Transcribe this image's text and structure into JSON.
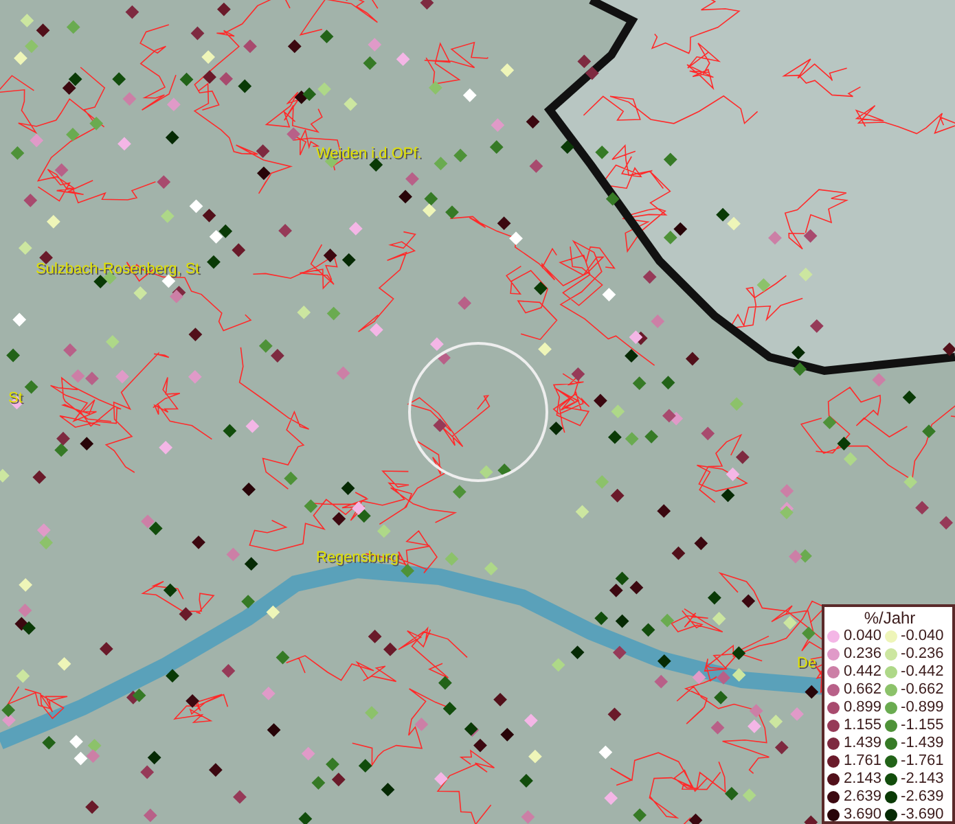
{
  "map": {
    "place_labels": [
      {
        "text": "Weiden i.d.OPf."
      },
      {
        "text": "Sulzbach-Rosenberg, St"
      },
      {
        "text": "St"
      },
      {
        "text": "Regensburg"
      },
      {
        "text": "De"
      }
    ]
  },
  "legend": {
    "title": "%/Jahr",
    "positive": [
      {
        "value": "0.040",
        "color": "#f4b6e6"
      },
      {
        "value": "0.236",
        "color": "#e09ac8"
      },
      {
        "value": "0.442",
        "color": "#cc7fa6"
      },
      {
        "value": "0.662",
        "color": "#b86088"
      },
      {
        "value": "0.899",
        "color": "#a84a6e"
      },
      {
        "value": "1.155",
        "color": "#963a58"
      },
      {
        "value": "1.439",
        "color": "#7e2a40"
      },
      {
        "value": "1.761",
        "color": "#6a1a2a"
      },
      {
        "value": "2.143",
        "color": "#52101a"
      },
      {
        "value": "2.639",
        "color": "#3c0810"
      },
      {
        "value": "3.690",
        "color": "#280408"
      }
    ],
    "negative": [
      {
        "value": "-0.040",
        "color": "#eef5b8"
      },
      {
        "value": "-0.236",
        "color": "#cce6a0"
      },
      {
        "value": "-0.442",
        "color": "#aed888"
      },
      {
        "value": "-0.662",
        "color": "#8cc26a"
      },
      {
        "value": "-0.899",
        "color": "#6aab50"
      },
      {
        "value": "-1.155",
        "color": "#4e9238"
      },
      {
        "value": "-1.439",
        "color": "#367a26"
      },
      {
        "value": "-1.761",
        "color": "#226318"
      },
      {
        "value": "-2.143",
        "color": "#124d0c"
      },
      {
        "value": "-2.639",
        "color": "#0a3a06"
      },
      {
        "value": "-3.690",
        "color": "#062a04"
      }
    ]
  }
}
